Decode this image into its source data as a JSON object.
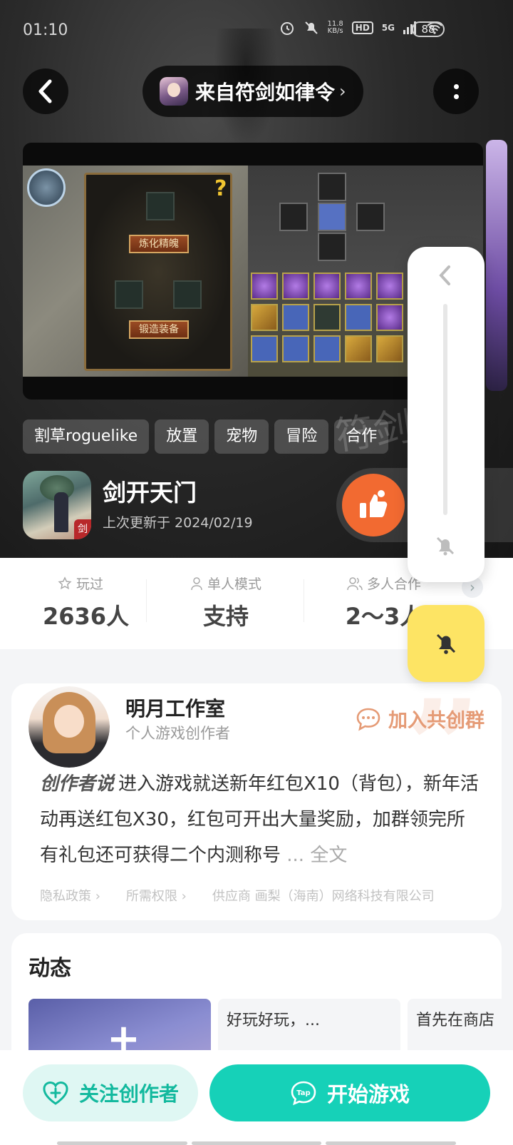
{
  "status_bar": {
    "time": "01:10",
    "net_speed_value": "11.8",
    "net_speed_unit": "KB/s",
    "hd": "HD",
    "network": "5G",
    "battery": "88"
  },
  "header": {
    "source_label": "来自符剑如律令",
    "source_chevron": "›"
  },
  "media": {
    "scene_buttons": [
      "炼化精魄",
      "锻造装备"
    ],
    "help_mark": "?"
  },
  "hero": {
    "calligraphy": "符剑"
  },
  "tags": [
    "割草roguelike",
    "放置",
    "宠物",
    "冒险",
    "合作"
  ],
  "game": {
    "icon_badge": "剑",
    "name": "剑开天门",
    "updated": "上次更新于 2024/02/19"
  },
  "stats": {
    "played_label": "玩过",
    "played_value": "2636人",
    "single_label": "单人模式",
    "single_value": "支持",
    "multi_label": "多人合作",
    "multi_value": "2〜3人",
    "more": "›"
  },
  "creator": {
    "name": "明月工作室",
    "role": "个人游戏创作者",
    "join_group": "加入共创群",
    "says_label": "创作者说",
    "text": "进入游戏就送新年红包X10（背包），新年活动再送红包X30，红包可开出大量奖励，加群领完所有礼包还可获得二个内测称号",
    "more": "... 全文",
    "links": {
      "privacy": "隐私政策 ›",
      "permissions": "所需权限 ›",
      "supplier": "供应商 画梨（海南）网络科技有限公司"
    }
  },
  "feed": {
    "title": "动态",
    "add": "+",
    "posts": [
      "好玩好玩，...",
      "首先在商店"
    ]
  },
  "actions": {
    "follow": "关注创作者",
    "start": "开始游戏"
  },
  "colors": {
    "accent": "#16d1b8",
    "like": "#f26a31",
    "join": "#e59b76",
    "bell": "#fde464"
  }
}
